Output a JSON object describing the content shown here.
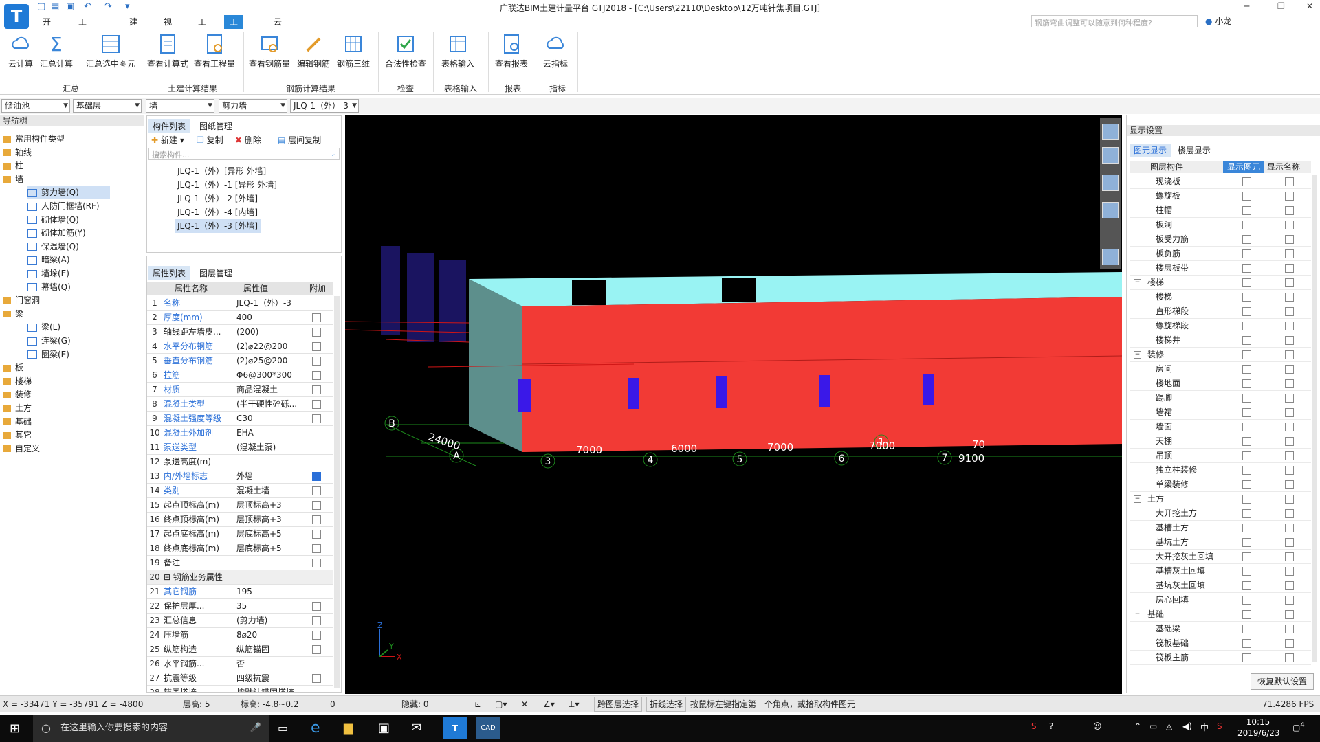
{
  "app": {
    "logo": "T",
    "title": "广联达BIM土建计量平台 GTJ2018 - [C:\\Users\\22110\\Desktop\\12万吨针焦项目.GTJ]",
    "search_placeholder": "钢筋弯曲调整可以随意到何种程度?",
    "user": "小龙"
  },
  "menu": [
    "开始",
    "工程设置",
    "建模",
    "视图",
    "工具",
    "工程量",
    "云应用"
  ],
  "ribbon": {
    "buttons": [
      "云计算",
      "汇总计算",
      "汇总选中图元",
      "查看计算式",
      "查看工程量",
      "查看钢筋量",
      "编辑钢筋",
      "钢筋三维",
      "合法性检查",
      "表格输入",
      "查看报表",
      "云指标"
    ],
    "groups": [
      "汇总",
      "土建计算结果",
      "钢筋计算结果",
      "检查",
      "表格输入",
      "报表",
      "指标"
    ]
  },
  "filters": [
    "储油池",
    "基础层",
    "墙",
    "剪力墙",
    "JLQ-1（外）-3"
  ],
  "nav": {
    "title": "导航树",
    "items": [
      {
        "label": "常用构件类型",
        "lvl": 0
      },
      {
        "label": "轴线",
        "lvl": 0
      },
      {
        "label": "柱",
        "lvl": 0
      },
      {
        "label": "墙",
        "lvl": 0
      },
      {
        "label": "剪力墙(Q)",
        "lvl": 1
      },
      {
        "label": "人防门框墙(RF)",
        "lvl": 1
      },
      {
        "label": "砌体墙(Q)",
        "lvl": 1
      },
      {
        "label": "砌体加筋(Y)",
        "lvl": 1
      },
      {
        "label": "保温墙(Q)",
        "lvl": 1
      },
      {
        "label": "暗梁(A)",
        "lvl": 1
      },
      {
        "label": "墙垛(E)",
        "lvl": 1
      },
      {
        "label": "幕墙(Q)",
        "lvl": 1
      },
      {
        "label": "门窗洞",
        "lvl": 0
      },
      {
        "label": "梁",
        "lvl": 0
      },
      {
        "label": "梁(L)",
        "lvl": 1
      },
      {
        "label": "连梁(G)",
        "lvl": 1
      },
      {
        "label": "圈梁(E)",
        "lvl": 1
      },
      {
        "label": "板",
        "lvl": 0
      },
      {
        "label": "楼梯",
        "lvl": 0
      },
      {
        "label": "装修",
        "lvl": 0
      },
      {
        "label": "土方",
        "lvl": 0
      },
      {
        "label": "基础",
        "lvl": 0
      },
      {
        "label": "其它",
        "lvl": 0
      },
      {
        "label": "自定义",
        "lvl": 0
      }
    ]
  },
  "components": {
    "tabs": [
      "构件列表",
      "图纸管理"
    ],
    "tools": [
      "新建",
      "复制",
      "删除",
      "层间复制"
    ],
    "search": "搜索构件...",
    "items": [
      "JLQ-1（外）[异形 外墙]",
      "JLQ-1（外）-1 [异形 外墙]",
      "JLQ-1（外）-2 [外墙]",
      "JLQ-1（外）-4 [内墙]",
      "JLQ-1（外）-3 [外墙]"
    ]
  },
  "properties": {
    "tabs": [
      "属性列表",
      "图层管理"
    ],
    "headers": [
      "属性名称",
      "属性值",
      "附加"
    ],
    "rows": [
      {
        "n": "1",
        "k": "名称",
        "v": "JLQ-1（外）-3",
        "link": true,
        "cb": ""
      },
      {
        "n": "2",
        "k": "厚度(mm)",
        "v": "400",
        "link": true,
        "cb": "0"
      },
      {
        "n": "3",
        "k": "轴线距左墙皮...",
        "v": "(200)",
        "link": false,
        "cb": "0"
      },
      {
        "n": "4",
        "k": "水平分布钢筋",
        "v": "(2)⌀22@200",
        "link": true,
        "cb": "0"
      },
      {
        "n": "5",
        "k": "垂直分布钢筋",
        "v": "(2)⌀25@200",
        "link": true,
        "cb": "0"
      },
      {
        "n": "6",
        "k": "拉筋",
        "v": "Φ6@300*300",
        "link": true,
        "cb": "0"
      },
      {
        "n": "7",
        "k": "材质",
        "v": "商品混凝土",
        "link": true,
        "cb": "0"
      },
      {
        "n": "8",
        "k": "混凝土类型",
        "v": "(半干硬性砼砾...",
        "link": true,
        "cb": "0"
      },
      {
        "n": "9",
        "k": "混凝土强度等级",
        "v": "C30",
        "link": true,
        "cb": "0"
      },
      {
        "n": "10",
        "k": "混凝土外加剂",
        "v": "EHA",
        "link": true,
        "cb": ""
      },
      {
        "n": "11",
        "k": "泵送类型",
        "v": "(混凝土泵)",
        "link": true,
        "cb": ""
      },
      {
        "n": "12",
        "k": "泵送高度(m)",
        "v": "",
        "link": false,
        "cb": ""
      },
      {
        "n": "13",
        "k": "内/外墙标志",
        "v": "外墙",
        "link": true,
        "cb": "1"
      },
      {
        "n": "14",
        "k": "类别",
        "v": "混凝土墙",
        "link": true,
        "cb": "0"
      },
      {
        "n": "15",
        "k": "起点顶标高(m)",
        "v": "层顶标高+3",
        "link": false,
        "cb": "0"
      },
      {
        "n": "16",
        "k": "终点顶标高(m)",
        "v": "层顶标高+3",
        "link": false,
        "cb": "0"
      },
      {
        "n": "17",
        "k": "起点底标高(m)",
        "v": "层底标高+5",
        "link": false,
        "cb": "0"
      },
      {
        "n": "18",
        "k": "终点底标高(m)",
        "v": "层底标高+5",
        "link": false,
        "cb": "0"
      },
      {
        "n": "19",
        "k": "备注",
        "v": "",
        "link": false,
        "cb": "0"
      },
      {
        "n": "20",
        "k": "⊟ 钢筋业务属性",
        "v": "",
        "link": false,
        "cb": ""
      },
      {
        "n": "21",
        "k": "  其它钢筋",
        "v": "195",
        "link": true,
        "cb": ""
      },
      {
        "n": "22",
        "k": "  保护层厚...",
        "v": "35",
        "link": false,
        "cb": "0"
      },
      {
        "n": "23",
        "k": "  汇总信息",
        "v": "(剪力墙)",
        "link": false,
        "cb": "0"
      },
      {
        "n": "24",
        "k": "  压墙筋",
        "v": "8⌀20",
        "link": false,
        "cb": "0"
      },
      {
        "n": "25",
        "k": "  纵筋构造",
        "v": "纵筋锚固",
        "link": false,
        "cb": "0"
      },
      {
        "n": "26",
        "k": "  水平钢筋...",
        "v": "否",
        "link": false,
        "cb": ""
      },
      {
        "n": "27",
        "k": "  抗震等级",
        "v": "四级抗震",
        "link": false,
        "cb": "0"
      },
      {
        "n": "28",
        "k": "  锚固搭接",
        "v": "按默认锚固搭接...",
        "link": false,
        "cb": ""
      }
    ]
  },
  "view": {
    "axis_labels": [
      "B",
      "A",
      "3",
      "4",
      "5",
      "6",
      "1",
      "7"
    ],
    "dims": [
      "24000",
      "7000",
      "6000",
      "7000",
      "7000",
      "9100",
      "70"
    ],
    "coord": [
      "Z",
      "Y",
      "X"
    ]
  },
  "display": {
    "title": "显示设置",
    "tabs": [
      "图元显示",
      "楼层显示"
    ],
    "headers": [
      "图层构件",
      "显示图元",
      "显示名称"
    ],
    "rows": [
      {
        "label": "现浇板",
        "grp": false
      },
      {
        "label": "螺旋板",
        "grp": false
      },
      {
        "label": "柱帽",
        "grp": false
      },
      {
        "label": "板洞",
        "grp": false
      },
      {
        "label": "板受力筋",
        "grp": false
      },
      {
        "label": "板负筋",
        "grp": false
      },
      {
        "label": "楼层板带",
        "grp": false
      },
      {
        "label": "楼梯",
        "grp": true
      },
      {
        "label": "楼梯",
        "grp": false
      },
      {
        "label": "直形梯段",
        "grp": false
      },
      {
        "label": "螺旋梯段",
        "grp": false
      },
      {
        "label": "楼梯井",
        "grp": false
      },
      {
        "label": "装修",
        "grp": true
      },
      {
        "label": "房间",
        "grp": false
      },
      {
        "label": "楼地面",
        "grp": false
      },
      {
        "label": "踢脚",
        "grp": false
      },
      {
        "label": "墙裙",
        "grp": false
      },
      {
        "label": "墙面",
        "grp": false
      },
      {
        "label": "天棚",
        "grp": false
      },
      {
        "label": "吊顶",
        "grp": false
      },
      {
        "label": "独立柱装修",
        "grp": false
      },
      {
        "label": "单梁装修",
        "grp": false
      },
      {
        "label": "土方",
        "grp": true
      },
      {
        "label": "大开挖土方",
        "grp": false
      },
      {
        "label": "基槽土方",
        "grp": false
      },
      {
        "label": "基坑土方",
        "grp": false
      },
      {
        "label": "大开挖灰土回填",
        "grp": false
      },
      {
        "label": "基槽灰土回填",
        "grp": false
      },
      {
        "label": "基坑灰土回填",
        "grp": false
      },
      {
        "label": "房心回填",
        "grp": false
      },
      {
        "label": "基础",
        "grp": true
      },
      {
        "label": "基础梁",
        "grp": false
      },
      {
        "label": "筏板基础",
        "grp": false
      },
      {
        "label": "筏板主筋",
        "grp": false
      }
    ],
    "restore": "恢复默认设置"
  },
  "status": {
    "coords": "X = -33471 Y = -35791 Z = -4800",
    "floor": "层高:  5",
    "elev": "标高:  -4.8~0.2",
    "zero": "0",
    "hidden": "隐藏:  0",
    "btn1": "跨图层选择",
    "btn2": "折线选择",
    "hint": "按鼠标左键指定第一个角点，或拾取构件图元",
    "fps": "71.4286 FPS"
  },
  "taskbar": {
    "search": "在这里输入你要搜索的内容",
    "time": "10:15",
    "date": "2019/6/23",
    "ime": "中",
    "notif": "4"
  }
}
